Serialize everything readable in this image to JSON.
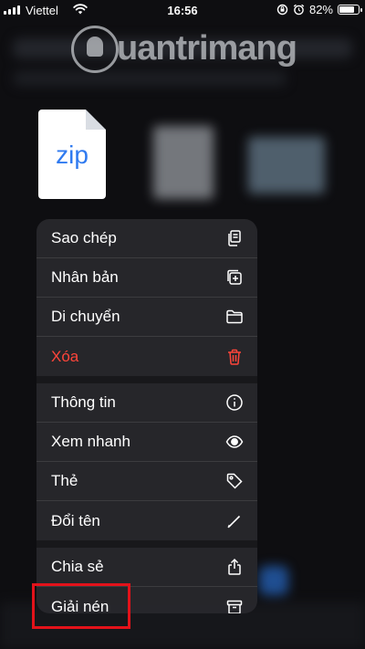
{
  "status_bar": {
    "carrier": "Viettel",
    "time": "16:56",
    "battery": "82%",
    "battery_level": 0.82
  },
  "watermark": {
    "text": "uantrimang"
  },
  "file": {
    "type_label": "zip"
  },
  "menu": {
    "items": [
      {
        "label": "Sao chép",
        "icon": "copy-icon"
      },
      {
        "label": "Nhân bản",
        "icon": "duplicate-icon"
      },
      {
        "label": "Di chuyển",
        "icon": "folder-icon"
      },
      {
        "label": "Xóa",
        "icon": "trash-icon",
        "destructive": true
      },
      {
        "label": "Thông tin",
        "icon": "info-icon"
      },
      {
        "label": "Xem nhanh",
        "icon": "eye-icon"
      },
      {
        "label": "Thẻ",
        "icon": "tag-icon"
      },
      {
        "label": "Đổi tên",
        "icon": "pencil-icon"
      },
      {
        "label": "Chia sẻ",
        "icon": "share-icon"
      },
      {
        "label": "Giải nén",
        "icon": "archive-icon"
      }
    ]
  },
  "colors": {
    "destructive": "#ff453a",
    "highlight": "#e3121a",
    "zip_blue": "#2f7af0"
  }
}
